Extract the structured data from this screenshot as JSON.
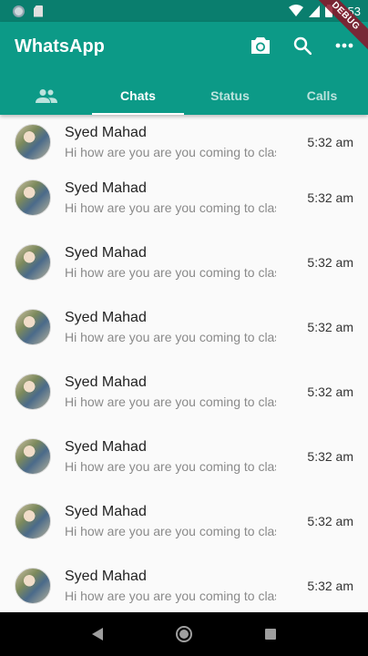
{
  "status_bar": {
    "time": "4:53"
  },
  "debug_banner": "DEBUG",
  "app_bar": {
    "title": "WhatsApp",
    "actions": [
      {
        "name": "camera-icon"
      },
      {
        "name": "search-icon"
      },
      {
        "name": "more-options-icon"
      }
    ]
  },
  "tabs": [
    {
      "label": "",
      "icon": "group-icon",
      "active": false
    },
    {
      "label": "Chats",
      "active": true
    },
    {
      "label": "Status",
      "active": false
    },
    {
      "label": "Calls",
      "active": false
    }
  ],
  "chats": [
    {
      "name": "Syed Mahad",
      "message": "Hi how are you are you coming to class",
      "time": "5:32 am"
    },
    {
      "name": "Syed Mahad",
      "message": "Hi how are you are you coming to class",
      "time": "5:32 am"
    },
    {
      "name": "Syed Mahad",
      "message": "Hi how are you are you coming to class",
      "time": "5:32 am"
    },
    {
      "name": "Syed Mahad",
      "message": "Hi how are you are you coming to class",
      "time": "5:32 am"
    },
    {
      "name": "Syed Mahad",
      "message": "Hi how are you are you coming to class",
      "time": "5:32 am"
    },
    {
      "name": "Syed Mahad",
      "message": "Hi how are you are you coming to class",
      "time": "5:32 am"
    },
    {
      "name": "Syed Mahad",
      "message": "Hi how are you are you coming to class",
      "time": "5:32 am"
    },
    {
      "name": "Syed Mahad",
      "message": "Hi how are you are you coming to class",
      "time": "5:32 am"
    }
  ],
  "colors": {
    "primary": "#0c9a87",
    "status_bar": "#0a7e6e"
  }
}
